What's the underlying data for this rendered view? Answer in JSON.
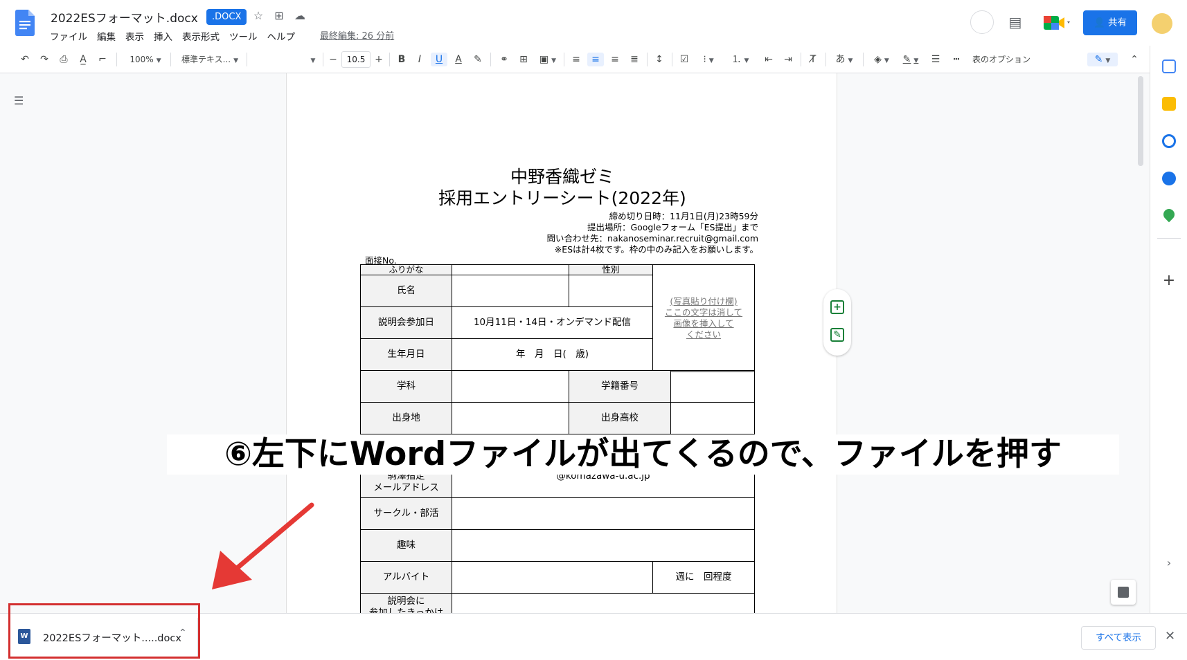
{
  "header": {
    "title": "2022ESフォーマット.docx",
    "badge": ".DOCX",
    "menu": [
      "ファイル",
      "編集",
      "表示",
      "挿入",
      "表示形式",
      "ツール",
      "ヘルプ"
    ],
    "last_edit": "最終編集: 26 分前",
    "share_label": "共有"
  },
  "toolbar": {
    "zoom": "100%",
    "style": "標準テキス...",
    "font_size": "10.5",
    "table_options": "表のオプション"
  },
  "document": {
    "title_line1": "中野香織ゼミ",
    "title_line2": "採用エントリーシート(2022年)",
    "deadline": "締め切り日時：11月1日(月)23時59分",
    "submit_place": "提出場所：Googleフォーム「ES提出」まで",
    "contact": "問い合わせ先：nakanoseminar.recruit@gmail.com",
    "note": "※ESは計4枚です。枠の中のみ記入をお願いします。",
    "interview_no": "面接No.",
    "form": {
      "furigana": "ふりがな",
      "gender": "性別",
      "name": "氏名",
      "session": "説明会参加日",
      "session_value": "10月11日・14日・オンデマンド配信",
      "birthdate": "生年月日",
      "birthdate_value": "年　月　日(　歳)",
      "department": "学科",
      "student_id": "学籍番号",
      "hometown": "出身地",
      "high_school": "出身高校",
      "email_label_1": "駒澤指定",
      "email_label_2": "メールアドレス",
      "email_value": "@komazawa-u.ac.jp",
      "circle": "サークル・部活",
      "hobby": "趣味",
      "part_time": "アルバイト",
      "part_time_value": "週に　回程度",
      "session_q_1": "説明会に",
      "session_q_2": "参加したきっかけ",
      "photo_1": "(写真貼り付け欄)",
      "photo_2": "ここの文字は消して",
      "photo_3": "画像を挿入して",
      "photo_4": "ください"
    }
  },
  "caption": "⑥左下にWordファイルが出てくるので、ファイルを押す",
  "download_bar": {
    "file_name": "2022ESフォーマット.....docx",
    "show_all": "すべて表示"
  },
  "colors": {
    "accent": "#1a73e8",
    "highlight_box": "#d32f2f",
    "word_icon": "#2b579a"
  }
}
